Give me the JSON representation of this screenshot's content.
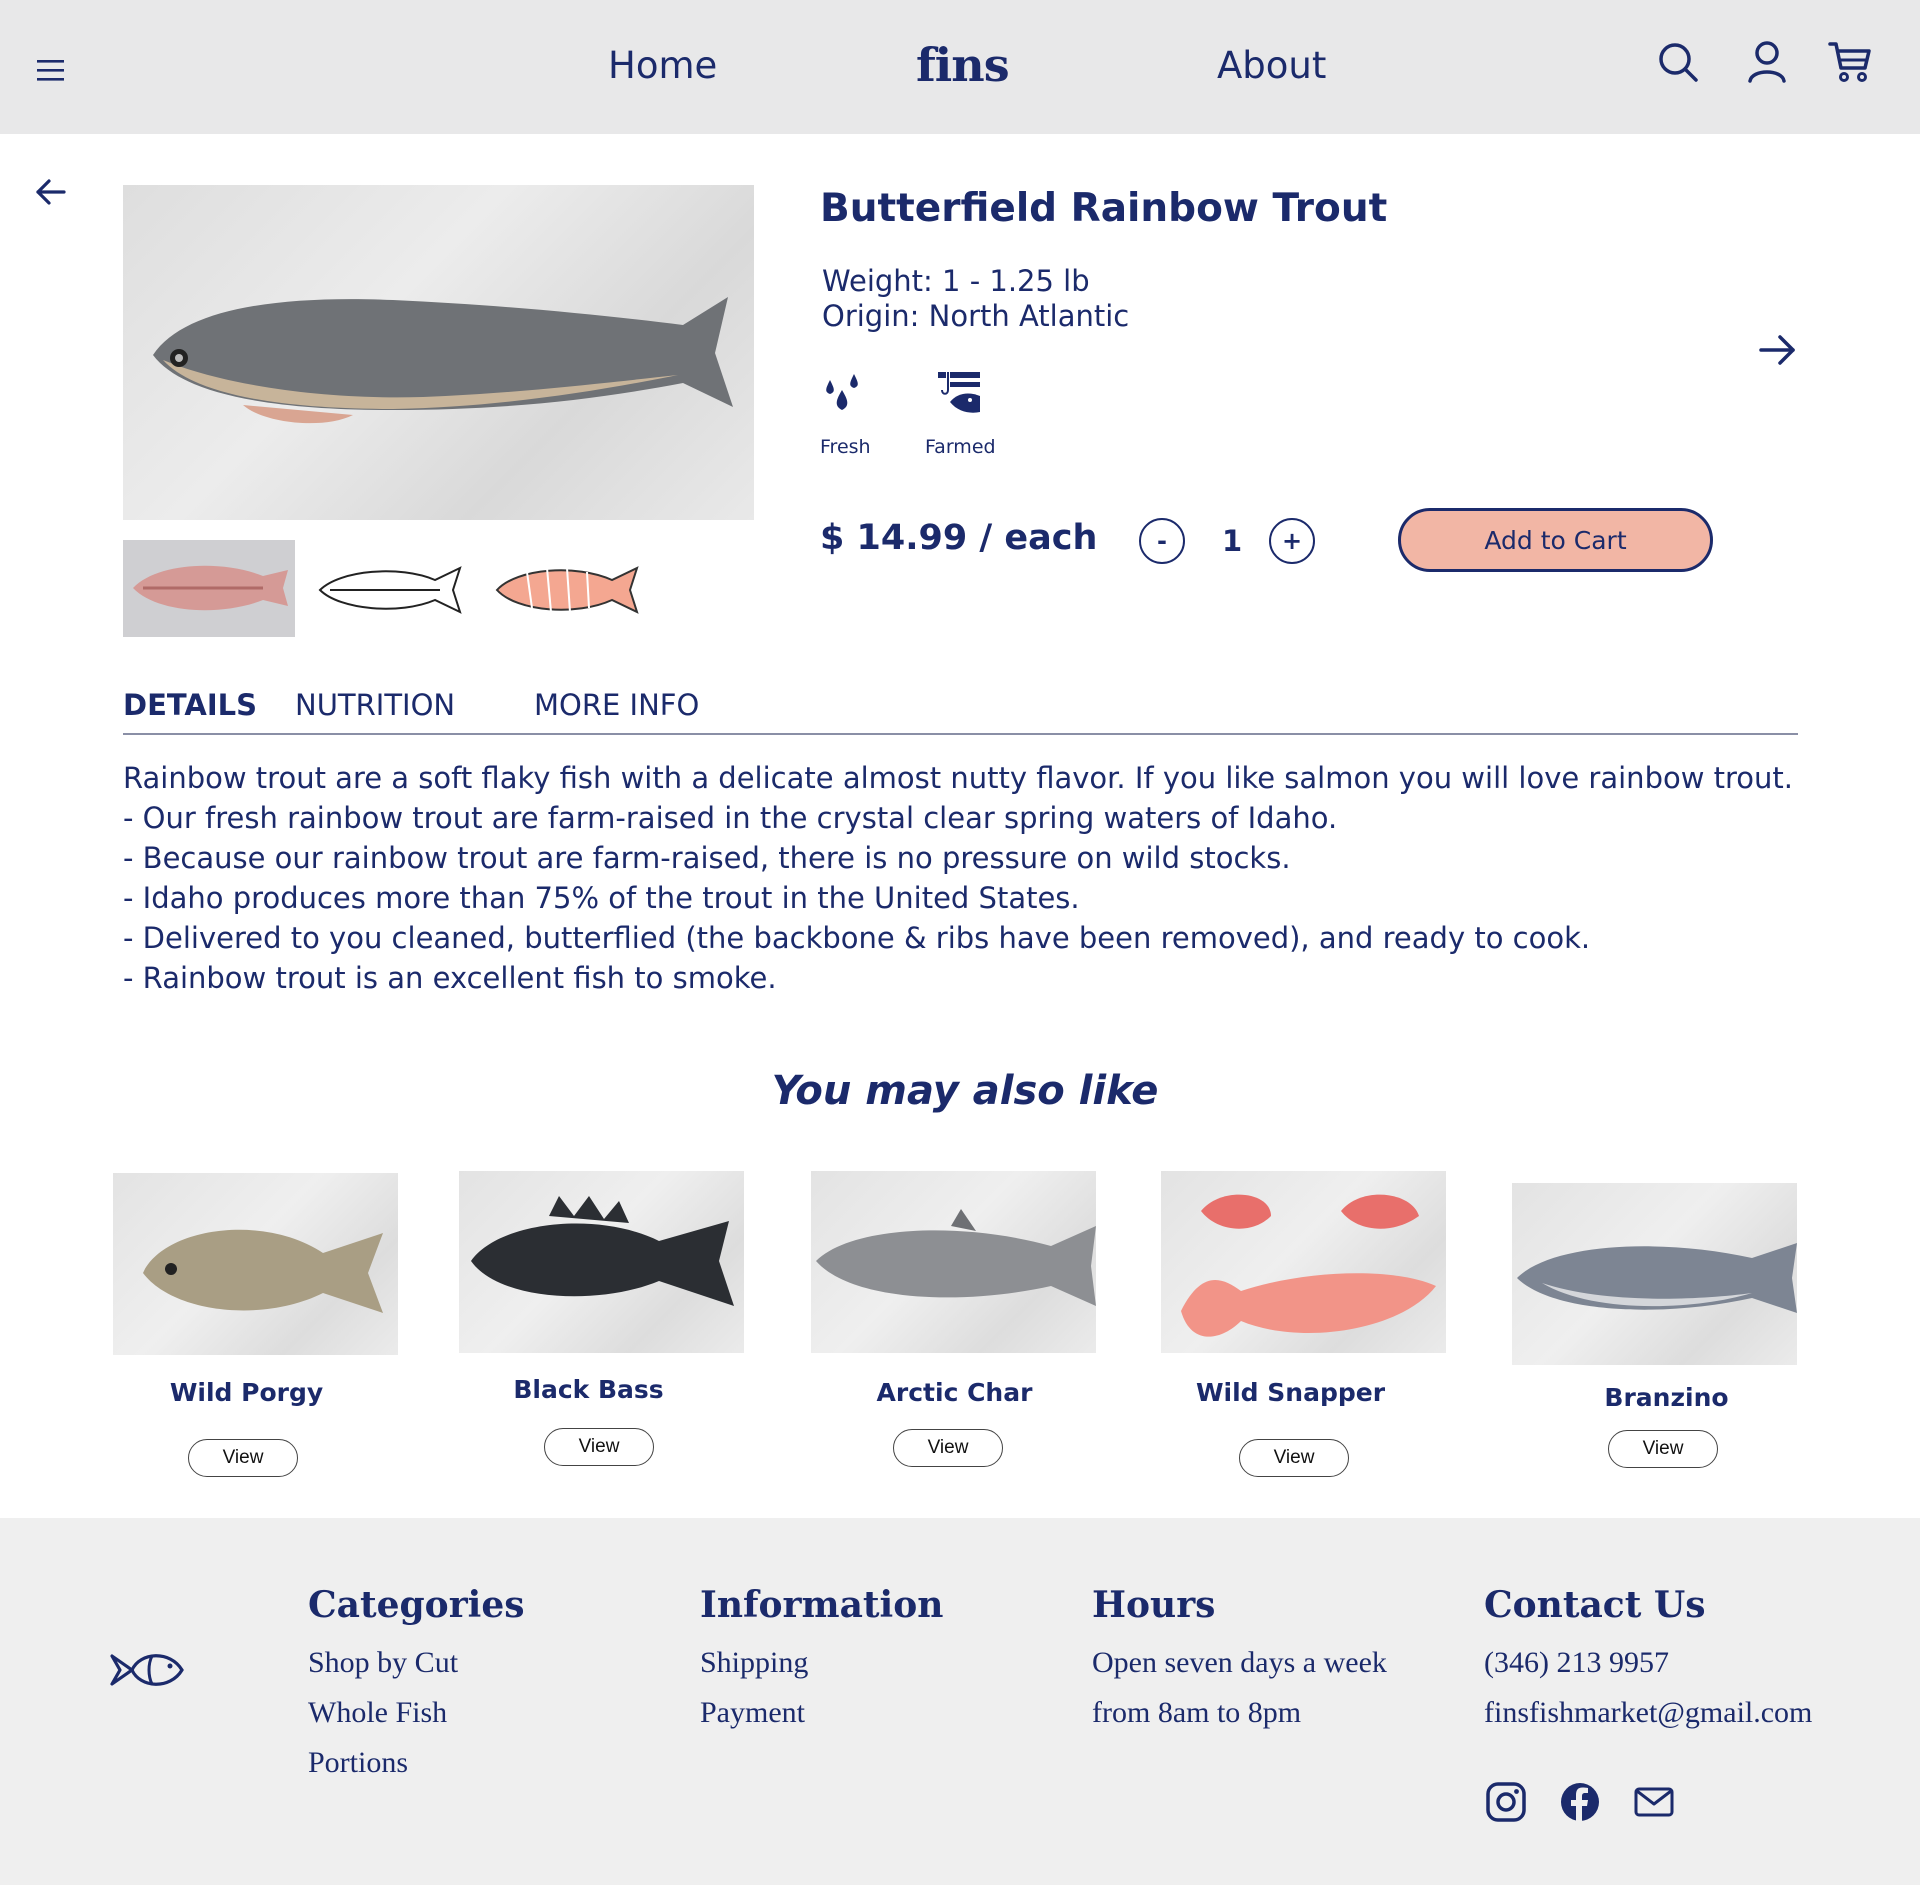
{
  "header": {
    "home_label": "Home",
    "logo": "fins",
    "about_label": "About"
  },
  "product": {
    "title": "Butterfield Rainbow Trout",
    "weight": "Weight: 1 - 1.25 lb",
    "origin": "Origin: North Atlantic",
    "attributes": [
      {
        "label": "Fresh",
        "icon": "water-drops-icon"
      },
      {
        "label": "Farmed",
        "icon": "fish-hook-icon"
      }
    ],
    "price": "$ 14.99 / each",
    "quantity": "1",
    "minus_label": "-",
    "plus_label": "+",
    "add_to_cart_label": "Add to Cart"
  },
  "tabs": [
    {
      "label": "DETAILS",
      "active": true
    },
    {
      "label": "NUTRITION",
      "active": false
    },
    {
      "label": "MORE INFO",
      "active": false
    }
  ],
  "details": [
    "Rainbow trout are a soft flaky fish with a delicate almost nutty flavor. If you like salmon you will love rainbow trout.",
    "- Our fresh rainbow trout are farm-raised in the crystal clear spring waters of Idaho.",
    "- Because our rainbow trout are farm-raised, there is no pressure on wild stocks.",
    "- Idaho produces more than 75% of the trout in the United States.",
    "- Delivered to you cleaned, butterflied (the backbone & ribs have been removed), and ready to cook.",
    "- Rainbow trout is an excellent fish to smoke."
  ],
  "recommendations": {
    "title": "You may also like",
    "view_label": "View",
    "items": [
      {
        "name": "Wild Porgy"
      },
      {
        "name": "Black Bass"
      },
      {
        "name": "Arctic Char"
      },
      {
        "name": "Wild Snapper"
      },
      {
        "name": "Branzino"
      }
    ]
  },
  "footer": {
    "categories": {
      "heading": "Categories",
      "items": [
        "Shop by Cut",
        "Whole Fish",
        "Portions"
      ]
    },
    "information": {
      "heading": "Information",
      "items": [
        "Shipping",
        "Payment"
      ]
    },
    "hours": {
      "heading": "Hours",
      "items": [
        "Open seven days a week",
        "from 8am to 8pm"
      ]
    },
    "contact": {
      "heading": "Contact Us",
      "items": [
        "(346) 213 9957",
        "finsfishmarket@gmail.com"
      ]
    },
    "social": [
      "instagram-icon",
      "facebook-icon",
      "mail-icon"
    ]
  },
  "colors": {
    "brand_navy": "#1b2a6b",
    "header_bg": "#e8e8e9",
    "footer_bg": "#efefef",
    "cart_button": "#f2b6a5"
  }
}
